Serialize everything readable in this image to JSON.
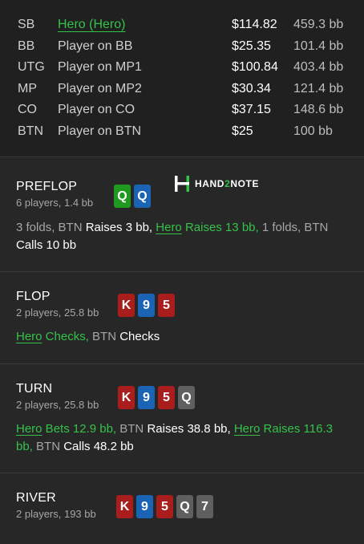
{
  "players": [
    {
      "pos": "SB",
      "name": "Hero (Hero)",
      "amount": "$114.82",
      "bb": "459.3 bb",
      "hero": true
    },
    {
      "pos": "BB",
      "name": "Player on BB",
      "amount": "$25.35",
      "bb": "101.4 bb",
      "hero": false
    },
    {
      "pos": "UTG",
      "name": "Player on MP1",
      "amount": "$100.84",
      "bb": "403.4 bb",
      "hero": false
    },
    {
      "pos": "MP",
      "name": "Player on MP2",
      "amount": "$30.34",
      "bb": "121.4 bb",
      "hero": false
    },
    {
      "pos": "CO",
      "name": "Player on CO",
      "amount": "$37.15",
      "bb": "148.6 bb",
      "hero": false
    },
    {
      "pos": "BTN",
      "name": "Player on BTN",
      "amount": "$25",
      "bb": "100 bb",
      "hero": false
    }
  ],
  "logo": {
    "part1": "HAND",
    "part2": "2",
    "part3": "NOTE"
  },
  "preflop": {
    "title": "PREFLOP",
    "subtitle": "6 players, 1.4 bb",
    "cards": [
      {
        "rank": "Q",
        "color": "#1f9a1f"
      },
      {
        "rank": "Q",
        "color": "#1b63b5"
      }
    ],
    "actions": {
      "a1": "3 folds, BTN ",
      "a2": "Raises 3 bb,",
      "a3": "Hero",
      "a4": " Raises 13 bb,",
      "a5": " 1 folds, BTN",
      "a6": "Calls 10 bb"
    }
  },
  "flop": {
    "title": "FLOP",
    "subtitle": "2 players, 25.8 bb",
    "cards": [
      {
        "rank": "K",
        "color": "#a91d1d"
      },
      {
        "rank": "9",
        "color": "#1b63b5"
      },
      {
        "rank": "5",
        "color": "#a91d1d"
      }
    ],
    "actions": {
      "a1": "Hero",
      "a2": " Checks,",
      "a3": " BTN ",
      "a4": "Checks"
    }
  },
  "turn": {
    "title": "TURN",
    "subtitle": "2 players, 25.8 bb",
    "cards": [
      {
        "rank": "K",
        "color": "#a91d1d"
      },
      {
        "rank": "9",
        "color": "#1b63b5"
      },
      {
        "rank": "5",
        "color": "#a91d1d"
      },
      {
        "rank": "Q",
        "color": "#5f5f5f"
      }
    ],
    "actions": {
      "a1": "Hero",
      "a2": " Bets 12.9 bb,",
      "a3": " BTN ",
      "a4": "Raises 38.8 bb,",
      "a5": "Hero",
      "a6": " Raises 116.3 bb,",
      "a7": " BTN ",
      "a8": "Calls 48.2 bb"
    }
  },
  "river": {
    "title": "RIVER",
    "subtitle": "2 players, 193 bb",
    "cards": [
      {
        "rank": "K",
        "color": "#a91d1d"
      },
      {
        "rank": "9",
        "color": "#1b63b5"
      },
      {
        "rank": "5",
        "color": "#a91d1d"
      },
      {
        "rank": "Q",
        "color": "#5f5f5f"
      },
      {
        "rank": "7",
        "color": "#5f5f5f"
      }
    ]
  }
}
